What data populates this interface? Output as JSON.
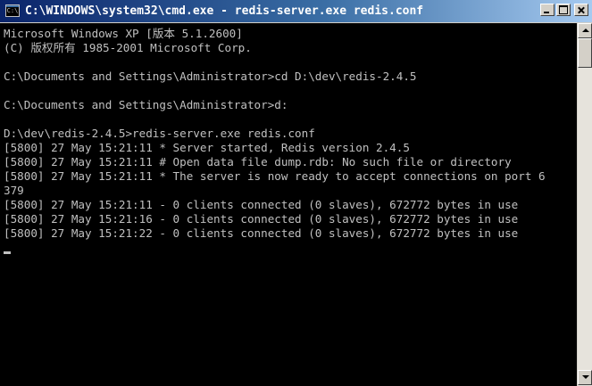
{
  "window": {
    "title": "C:\\WINDOWS\\system32\\cmd.exe - redis-server.exe redis.conf",
    "icon": "cmd-icon",
    "icon_text": "C:\\",
    "controls": [
      "minimize-icon",
      "maximize-icon",
      "close-icon"
    ]
  },
  "console": {
    "lines": [
      "Microsoft Windows XP [版本 5.1.2600]",
      "(C) 版权所有 1985-2001 Microsoft Corp.",
      "",
      "C:\\Documents and Settings\\Administrator>cd D:\\dev\\redis-2.4.5",
      "",
      "C:\\Documents and Settings\\Administrator>d:",
      "",
      "D:\\dev\\redis-2.4.5>redis-server.exe redis.conf",
      "[5800] 27 May 15:21:11 * Server started, Redis version 2.4.5",
      "[5800] 27 May 15:21:11 # Open data file dump.rdb: No such file or directory",
      "[5800] 27 May 15:21:11 * The server is now ready to accept connections on port 6",
      "379",
      "[5800] 27 May 15:21:11 - 0 clients connected (0 slaves), 672772 bytes in use",
      "[5800] 27 May 15:21:16 - 0 clients connected (0 slaves), 672772 bytes in use",
      "[5800] 27 May 15:21:22 - 0 clients connected (0 slaves), 672772 bytes in use"
    ]
  },
  "colors": {
    "console_background": "#000000",
    "console_text": "#c0c0c0",
    "titlebar_start": "#0a246a",
    "titlebar_end": "#a6caf0"
  }
}
